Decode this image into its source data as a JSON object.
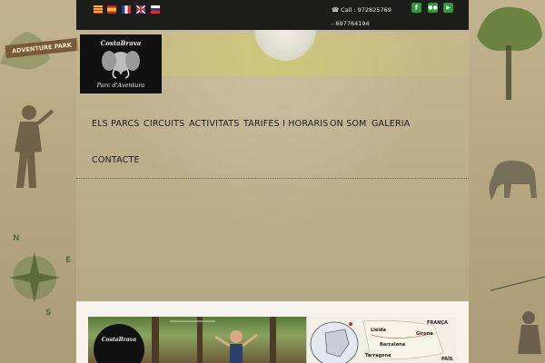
{
  "topbar": {
    "languages": [
      {
        "name": "catalan-flag-icon",
        "color": "#d9a21b"
      },
      {
        "name": "spanish-flag-icon",
        "color": "#c8202a"
      },
      {
        "name": "french-flag-icon",
        "color": "#2a3e9a"
      },
      {
        "name": "english-flag-icon",
        "color": "#1f3c8a"
      },
      {
        "name": "russian-flag-icon",
        "color": "#d23232"
      }
    ],
    "phone_text": "Call : 972825769 - 697764194",
    "social": [
      {
        "name": "facebook-icon",
        "glyph": "f"
      },
      {
        "name": "flickr-icon",
        "glyph": "••"
      },
      {
        "name": "youtube-icon",
        "glyph": "▶"
      }
    ]
  },
  "sign": {
    "label": "ADVENTURE PARK"
  },
  "logo": {
    "line1": "CostaBrava",
    "line2": "Parc d'Aventura"
  },
  "nav": {
    "items": [
      "ELS PARCS",
      "CIRCUITS",
      "ACTIVITATS",
      "TARIFES I HORARIS",
      "ON SOM",
      "GALERIA",
      "CONTACTE"
    ]
  },
  "compass": {
    "n": "N",
    "e": "E",
    "s": "S"
  },
  "photo": {
    "logo_text": "CostaBrava"
  },
  "map": {
    "labels": [
      "Girona",
      "Barcelona",
      "Tarragona",
      "Lleida",
      "FRANÇA",
      "PAÏS"
    ]
  },
  "colors": {
    "accent_green": "#2e9a3b",
    "topbar": "#1d1d1b",
    "text": "#1c1c1c"
  }
}
